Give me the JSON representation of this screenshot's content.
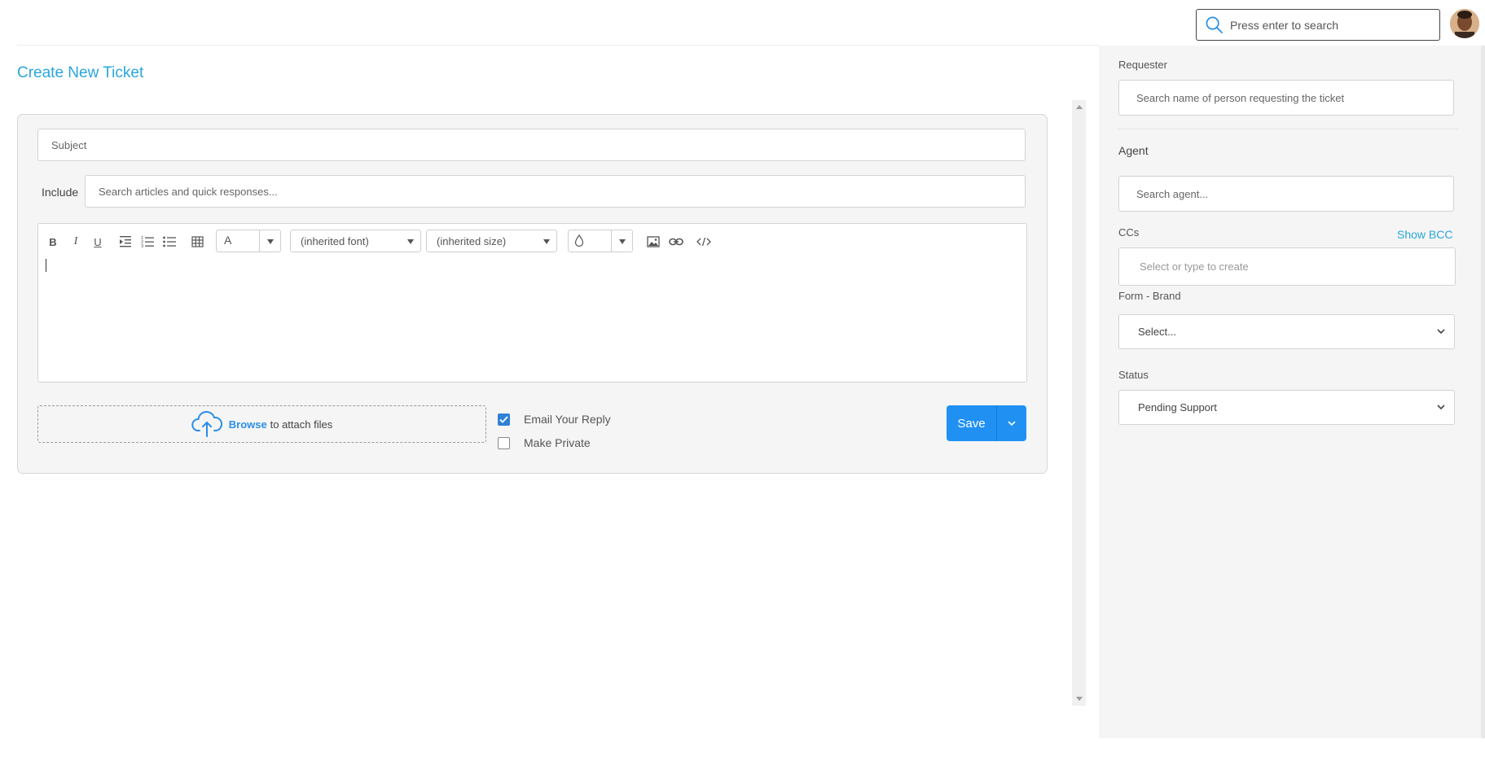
{
  "header": {
    "search_placeholder": "Press enter to search"
  },
  "page": {
    "title": "Create New Ticket"
  },
  "form": {
    "subject_placeholder": "Subject",
    "include_label": "Include",
    "include_placeholder": "Search articles and quick responses...",
    "toolbar": {
      "bold": "B",
      "italic": "I",
      "underline": "U",
      "font_color": "A",
      "font_family": "(inherited font)",
      "font_size": "(inherited size)"
    },
    "attach": {
      "browse": "Browse",
      "rest": "to attach files"
    },
    "email_reply_label": "Email Your Reply",
    "email_reply_checked": true,
    "make_private_label": "Make Private",
    "make_private_checked": false,
    "save_label": "Save"
  },
  "sidebar": {
    "requester_label": "Requester",
    "requester_placeholder": "Search name of person requesting the ticket",
    "agent_label": "Agent",
    "agent_placeholder": "Search agent...",
    "ccs_label": "CCs",
    "show_bcc": "Show BCC",
    "ccs_placeholder": "Select or type to create",
    "brand_label": "Form - Brand",
    "brand_value": "Select...",
    "status_label": "Status",
    "status_value": "Pending Support"
  },
  "colors": {
    "accent": "#29a6dc",
    "primary_button": "#2091f3"
  }
}
